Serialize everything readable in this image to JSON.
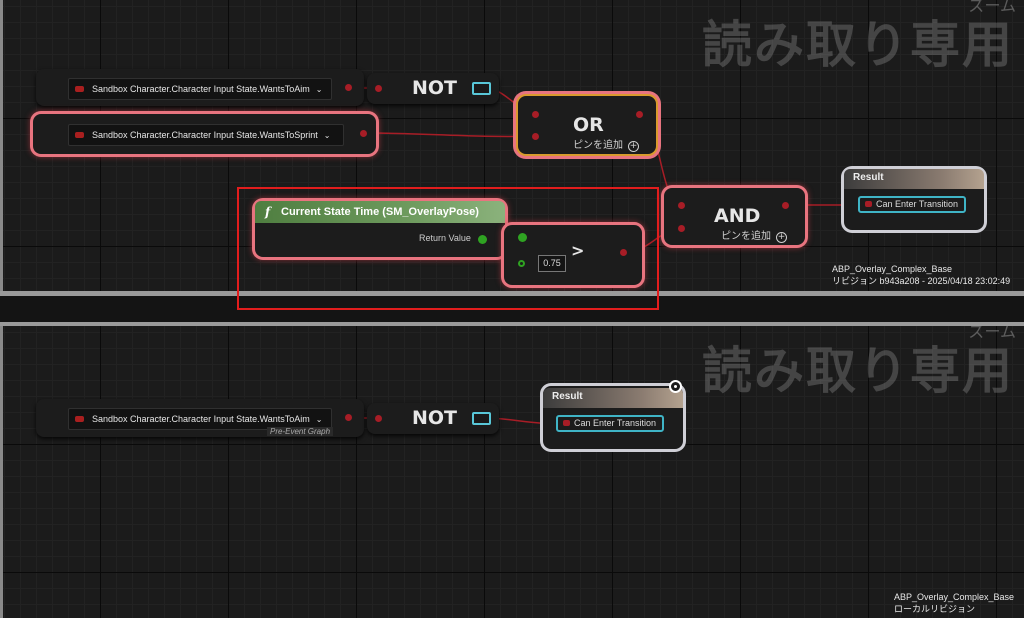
{
  "colors": {
    "bool_pin": "#a71d26",
    "selection": "#e8747f",
    "function_header": "#5d8a4c",
    "result_pin": "#3fb4c6",
    "grid_bg": "#1b1b1b",
    "highlight_box": "#e21d1d"
  },
  "watermark": "読み取り専用",
  "zoom_label": "ズーム",
  "top_graph": {
    "var1": {
      "label": "Sandbox Character.Character Input State.WantsToAim"
    },
    "var2": {
      "label": "Sandbox Character.Character Input State.WantsToSprint"
    },
    "not_node": {
      "label": "NOT"
    },
    "or_node": {
      "label": "OR",
      "add_pin": "ピンを追加"
    },
    "and_node": {
      "label": "AND",
      "add_pin": "ピンを追加"
    },
    "func_node": {
      "title": "Current State Time (SM_OverlayPose)",
      "return_label": "Return Value"
    },
    "greater_node": {
      "label": ">",
      "value": "0.75"
    },
    "result_node": {
      "title": "Result",
      "pin": "Can Enter Transition"
    },
    "caption": {
      "line1": "ABP_Overlay_Complex_Base",
      "line2": "リビジョン b943a208 - 2025/04/18 23:02:49"
    }
  },
  "bottom_graph": {
    "var1": {
      "label": "Sandbox Character.Character Input State.WantsToAim",
      "sub": "Pre-Event Graph"
    },
    "not_node": {
      "label": "NOT"
    },
    "result_node": {
      "title": "Result",
      "pin": "Can Enter Transition"
    },
    "caption": {
      "line1": "ABP_Overlay_Complex_Base",
      "line2": "ローカルリビジョン"
    }
  },
  "icons": {
    "function": "f",
    "chevron": "chevron-down-icon",
    "plus": "add-pin-icon",
    "watch": "watch-icon"
  }
}
